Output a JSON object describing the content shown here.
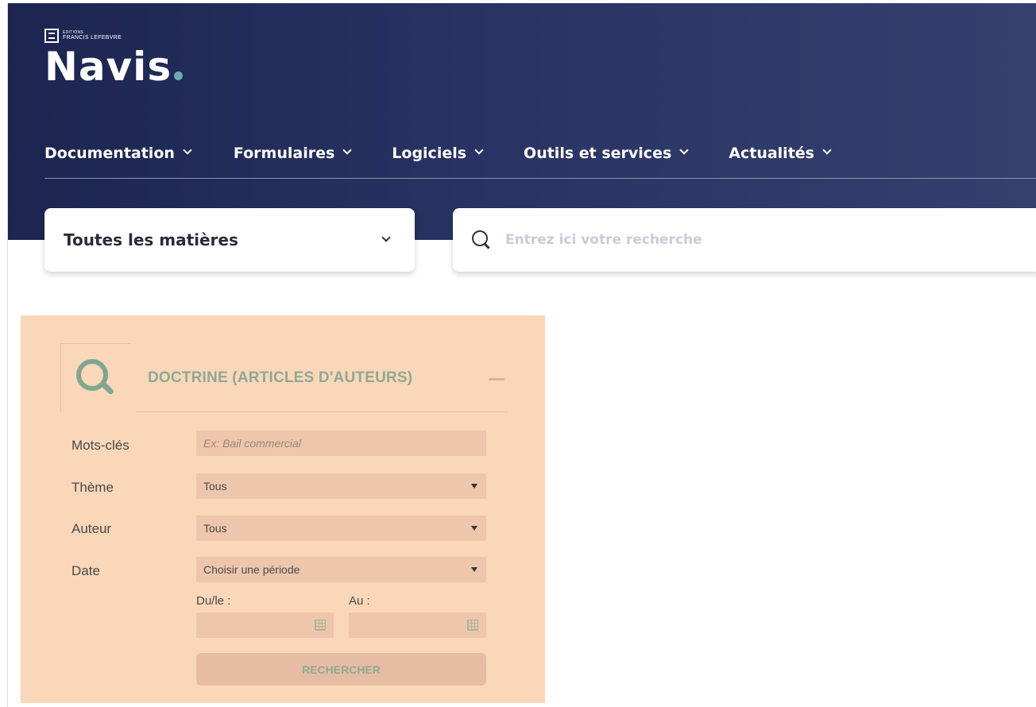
{
  "brand": {
    "editions": "EDITIONS",
    "publisher": "FRANCIS LEFEBVRE",
    "name": "Navis"
  },
  "nav": {
    "items": [
      {
        "label": "Documentation",
        "icon": "chevron-down-icon"
      },
      {
        "label": "Formulaires",
        "icon": "chevron-down-icon"
      },
      {
        "label": "Logiciels",
        "icon": "chevron-down-icon"
      },
      {
        "label": "Outils et services",
        "icon": "chevron-down-icon"
      },
      {
        "label": "Actualités",
        "icon": "chevron-down-icon"
      }
    ]
  },
  "subject_select": {
    "value": "Toutes les matières",
    "icon": "chevron-down-icon"
  },
  "search": {
    "placeholder": "Entrez ici votre recherche",
    "icon": "search-icon"
  },
  "panel": {
    "title": "DOCTRINE (ARTICLES D'AUTEURS)",
    "icon": "search-icon",
    "collapse_icon": "minus-icon",
    "keywords_label": "Mots-clés",
    "keywords_placeholder": "Ex: Bail commercial",
    "theme_label": "Thème",
    "theme_value": "Tous",
    "author_label": "Auteur",
    "author_value": "Tous",
    "date_label": "Date",
    "date_value": "Choisir une période",
    "from_label": "Du/le :",
    "to_label": "Au :",
    "calendar_icon": "calendar-icon",
    "submit_label": "RECHERCHER"
  },
  "colors": {
    "header_bg": "#283363",
    "panel_bg": "#f9d7b8",
    "field_bg": "#eec6ac",
    "accent_green": "#7fa691",
    "brand_dot": "#6aadb2"
  }
}
